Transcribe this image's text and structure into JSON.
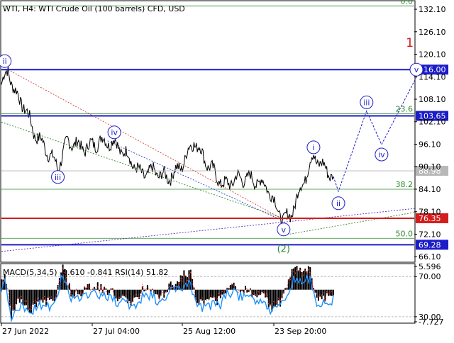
{
  "chart_data": {
    "type": "line",
    "title": "WTI, H4:  WTI Crude Oil (100 barrels) CFD, USD",
    "price_axis": {
      "ylim": [
        65.0,
        134.0
      ],
      "ticks": [
        "132.10",
        "126.10",
        "120.10",
        "114.10",
        "108.10",
        "102.10",
        "96.10",
        "90.10",
        "84.10",
        "78.10",
        "72.10",
        "66.10"
      ]
    },
    "x_ticks": [
      "27 Jun 2022",
      "27 Jul 04:00",
      "25 Aug 12:00",
      "23 Sep 20:00"
    ],
    "price_series": {
      "name": "",
      "x_range": [
        0,
        100
      ],
      "anchors": [
        [
          0,
          112
        ],
        [
          2,
          116
        ],
        [
          4,
          110
        ],
        [
          7,
          106
        ],
        [
          10,
          99
        ],
        [
          13,
          95.5
        ],
        [
          17,
          90
        ],
        [
          20,
          97
        ],
        [
          25,
          95
        ],
        [
          30,
          97
        ],
        [
          34,
          96.5
        ],
        [
          38,
          93
        ],
        [
          42,
          88
        ],
        [
          46,
          89
        ],
        [
          50,
          87
        ],
        [
          54,
          90
        ],
        [
          58,
          97
        ],
        [
          62,
          91
        ],
        [
          67,
          85
        ],
        [
          71,
          87
        ],
        [
          75,
          87
        ],
        [
          80,
          85
        ],
        [
          83,
          79
        ],
        [
          85,
          76
        ],
        [
          87,
          77
        ],
        [
          90,
          84
        ],
        [
          94,
          93
        ],
        [
          97,
          90
        ],
        [
          100,
          87.5
        ]
      ]
    },
    "fib_levels": [
      {
        "label": "0.0",
        "value": 133.0,
        "color": "#2e8b2e"
      },
      {
        "label": "23.6",
        "value": 104.2,
        "color": "#2e8b2e"
      },
      {
        "label": "38.2",
        "value": 84.1,
        "color": "#2e8b2e"
      },
      {
        "label": "50.0",
        "value": 71.0,
        "color": "#2e8b2e"
      }
    ],
    "horizontal_levels": [
      {
        "price": "116.00",
        "value": 116.0,
        "color": "#1c1cc8"
      },
      {
        "price": "103.65",
        "value": 103.65,
        "color": "#1c1cc8"
      },
      {
        "price": "76.35",
        "value": 76.35,
        "color": "#d41c1c"
      },
      {
        "price": "69.28",
        "value": 69.28,
        "color": "#1c1cc8"
      }
    ],
    "current_price": {
      "price": "88.98",
      "value": 89.0
    },
    "wave_labels": [
      {
        "label": "ii",
        "t": 1,
        "value": 116.0,
        "pos": "above"
      },
      {
        "label": "iii",
        "t": 17,
        "value": 90.0,
        "pos": "below"
      },
      {
        "label": "iv",
        "t": 34,
        "value": 97.0,
        "pos": "above"
      },
      {
        "label": "v",
        "t": 85,
        "value": 76.0,
        "pos": "below"
      },
      {
        "label": "(2)",
        "t": 85,
        "value": 71.0,
        "pos": "below"
      },
      {
        "label": "i",
        "t": 94,
        "value": 93.0,
        "pos": "above"
      },
      {
        "label": "ii",
        "t": 101.5,
        "value": 83.0,
        "pos": "below"
      },
      {
        "label": "iii",
        "t": 110,
        "value": 105.0,
        "pos": "above"
      },
      {
        "label": "iv",
        "t": 114.5,
        "value": 96.0,
        "pos": "below"
      },
      {
        "label": "v",
        "t": 125,
        "value": 116.0,
        "pos": "on"
      },
      {
        "label": "1",
        "t": 123,
        "value": 121.0,
        "pos": "above",
        "color": "#d41c1c"
      }
    ],
    "forecast_path": [
      [
        100,
        87.5
      ],
      [
        101.5,
        83.5
      ],
      [
        110,
        105
      ],
      [
        114.5,
        96
      ],
      [
        125,
        114
      ]
    ],
    "trendlines": [
      {
        "points": [
          [
            2,
            116
          ],
          [
            85,
            76
          ]
        ],
        "color": "#d43a3a"
      },
      {
        "points": [
          [
            32,
            97
          ],
          [
            84,
            76
          ]
        ],
        "color": "#2a40d0"
      },
      {
        "points": [
          [
            0,
            102
          ],
          [
            86,
            76
          ]
        ],
        "color": "#2e8b2e"
      },
      {
        "points": [
          [
            86,
            72
          ],
          [
            125,
            78
          ]
        ],
        "color": "#2e8b2e"
      },
      {
        "points": [
          [
            0,
            67.5
          ],
          [
            125,
            79
          ]
        ],
        "color": "#5b2db0"
      }
    ],
    "indicator": {
      "title": "MACD(5,34,5) -0.610 -0.841 RSI(14) 51.82",
      "ticks": [
        "5.596",
        "70.00",
        "30.00",
        "-7.727"
      ],
      "macd_range": [
        -7.727,
        5.596
      ],
      "rsi_range": [
        25,
        80
      ]
    }
  }
}
